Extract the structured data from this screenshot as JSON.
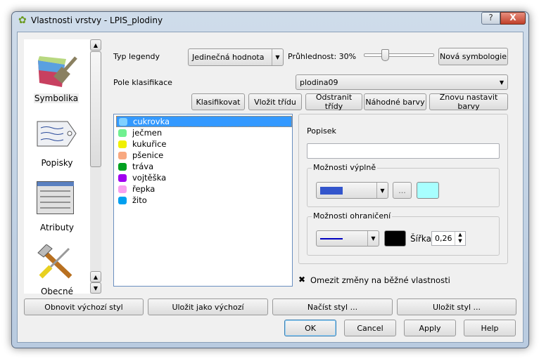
{
  "window": {
    "title": "Vlastnosti vrstvy - LPIS_plodiny",
    "help": "?",
    "close": "X"
  },
  "sidebar": {
    "items": [
      {
        "label": "Symbolika",
        "icon": "paintbrush-icon"
      },
      {
        "label": "Popisky",
        "icon": "label-tag-icon"
      },
      {
        "label": "Atributy",
        "icon": "table-icon"
      },
      {
        "label": "Obecné",
        "icon": "tools-icon"
      }
    ]
  },
  "symbology": {
    "legend_type_label": "Typ legendy",
    "legend_type_value": "Jedinečná hodnota",
    "transparency_label": "Průhlednost: 30%",
    "transparency_percent": 30,
    "new_symbology": "Nová symbologie",
    "class_field_label": "Pole klasifikace",
    "class_field_value": "plodina09",
    "buttons": [
      "Klasifikovat",
      "Vložit třídu",
      "Odstranit třídy",
      "Náhodné barvy",
      "Znovu nastavit barvy"
    ],
    "classes": [
      {
        "label": "cukrovka",
        "color": "#80d0ff"
      },
      {
        "label": "ječmen",
        "color": "#70f090"
      },
      {
        "label": "kukuřice",
        "color": "#f0f000"
      },
      {
        "label": "pšenice",
        "color": "#f8a880"
      },
      {
        "label": "tráva",
        "color": "#00a020"
      },
      {
        "label": "vojtěška",
        "color": "#a000f0"
      },
      {
        "label": "řepka",
        "color": "#f8a0f0"
      },
      {
        "label": "žito",
        "color": "#00a0f0"
      }
    ],
    "selected_index": 0,
    "popisek_label": "Popisek",
    "popisek_value": "",
    "fill_group": "Možnosti výplně",
    "fill_color": "#3355cc",
    "fill_swatch": "#a8ffff",
    "dots": "...",
    "border_group": "Možnosti ohraničení",
    "border_line_color": "#0000c0",
    "border_color": "#000000",
    "width_label": "Šířka",
    "width_value": "0,26",
    "restrict_label": "Omezit změny na běžné vlastnosti",
    "restrict_checked": true
  },
  "footer": {
    "style_buttons": [
      "Obnovit výchozí styl",
      "Uložit jako výchozí",
      "Načíst styl ...",
      "Uložit styl ..."
    ],
    "ok": "OK",
    "cancel": "Cancel",
    "apply": "Apply",
    "help": "Help"
  }
}
